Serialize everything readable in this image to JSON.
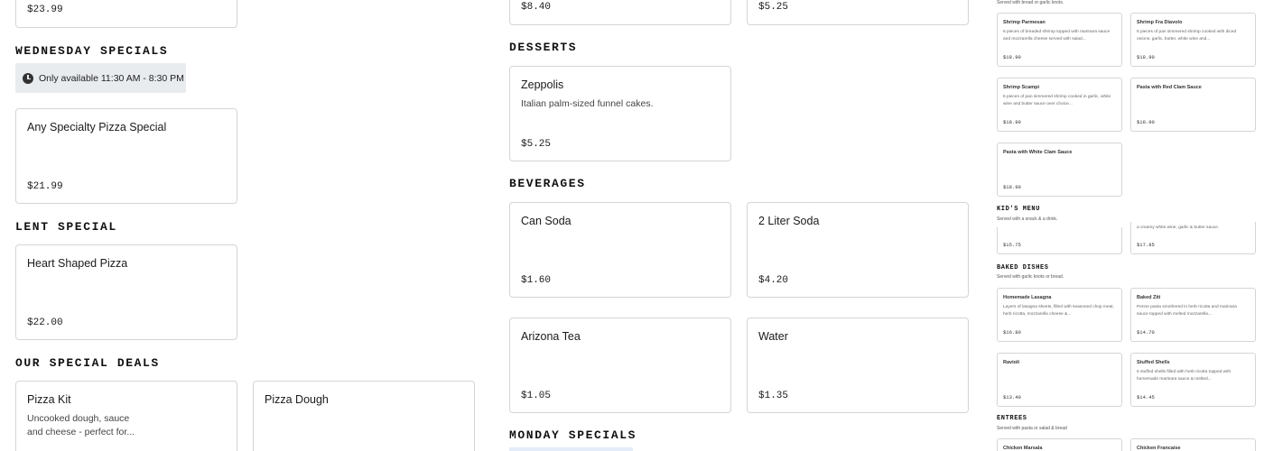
{
  "left": {
    "top_card": {
      "price": "$23.99"
    },
    "wednesday": {
      "title": "WEDNESDAY SPECIALS",
      "availability": "Only available 11:30 AM - 8:30 PM",
      "item": {
        "name": "Any Specialty Pizza Special",
        "price": "$21.99"
      }
    },
    "lent": {
      "title": "LENT SPECIAL",
      "item": {
        "name": "Heart Shaped Pizza",
        "price": "$22.00"
      }
    },
    "deals": {
      "title": "OUR SPECIAL DEALS",
      "items": [
        {
          "name": "Pizza Kit",
          "desc": "Uncooked dough, sauce and cheese - perfect for..."
        },
        {
          "name": "Pizza Dough"
        }
      ]
    }
  },
  "middle": {
    "top_prices": [
      "$8.40",
      "$5.25"
    ],
    "desserts": {
      "title": "DESSERTS",
      "item": {
        "name": "Zeppolis",
        "desc": "Italian palm-sized funnel cakes.",
        "price": "$5.25"
      }
    },
    "beverages": {
      "title": "BEVERAGES",
      "items": [
        {
          "name": "Can Soda",
          "price": "$1.60"
        },
        {
          "name": "2 Liter Soda",
          "price": "$4.20"
        },
        {
          "name": "Arizona Tea",
          "price": "$1.05"
        },
        {
          "name": "Water",
          "price": "$1.35"
        }
      ]
    },
    "monday": {
      "title": "MONDAY SPECIALS"
    }
  },
  "right": {
    "top_note": "Served with bread or garlic knots.",
    "cards": [
      {
        "name": "Shrimp Parmesan",
        "desc": "6 pieces of breaded shrimp topped with marinara sauce and mozzarella cheese served with salad...",
        "price": "$18.90"
      },
      {
        "name": "Shrimp Fra Diavolo",
        "desc": "6 pieces of pan simmered shrimp cooked with diced onions, garlic, butter, white wine and...",
        "price": "$18.90"
      },
      {
        "name": "Shrimp Scampi",
        "desc": "6 pieces of pan simmered shrimp cooked in garlic, white wine and butter sauce over choice...",
        "price": "$18.90"
      },
      {
        "name": "Pasta with Red Clam Sauce",
        "desc": "",
        "price": "$18.90"
      },
      {
        "name": "Pasta with White Clam Sauce",
        "desc": "",
        "price": "$18.90"
      }
    ],
    "kids": {
      "title": "KID'S MENU",
      "sub": "Served with a snack & a drink.",
      "cards": [
        {
          "desc": "",
          "price": "$15.75"
        },
        {
          "desc": "a creamy white wine, garlic & butter sauce.",
          "price": "$17.85"
        }
      ]
    },
    "baked": {
      "title": "BAKED DISHES",
      "sub": "Served with garlic knots or bread.",
      "cards": [
        {
          "name": "Homemade Lasagna",
          "desc": "Layers of lasagna sheets, filled with seasoned chop meat, herb ricotta, mozzarella cheese &...",
          "price": "$16.80"
        },
        {
          "name": "Baked Ziti",
          "desc": "Penne pasta smothered in herb ricotta and marinara sauce topped with melted mozzarella...",
          "price": "$14.70"
        },
        {
          "name": "Ravioli",
          "desc": "",
          "price": "$13.40"
        },
        {
          "name": "Stuffed Shells",
          "desc": "5 stuffed shells filled with herb ricotta topped with homemade marinara sauce & melted...",
          "price": "$14.45"
        }
      ]
    },
    "entrees": {
      "title": "ENTREES",
      "sub": "Served with pasta or salad & bread",
      "cards": [
        {
          "name": "Chicken Marsala"
        },
        {
          "name": "Chicken Francaise"
        }
      ]
    }
  }
}
